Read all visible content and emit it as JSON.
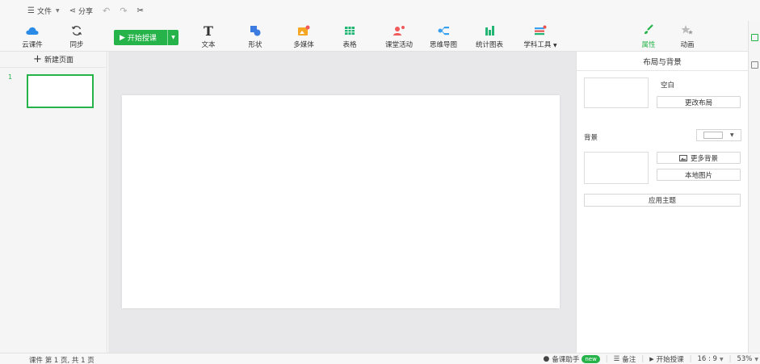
{
  "menubar": {
    "file_label": "文件",
    "share_label": "分享"
  },
  "ribbon": {
    "cloud_label": "云课件",
    "sync_label": "同步",
    "start_label": "开始授课",
    "text_label": "文本",
    "shape_label": "形状",
    "media_label": "多媒体",
    "table_label": "表格",
    "activity_label": "课堂活动",
    "mindmap_label": "思维导图",
    "chart_label": "统计图表",
    "subject_tools_label": "学科工具"
  },
  "right_tabs": {
    "attributes_label": "属性",
    "animation_label": "动画"
  },
  "left_panel": {
    "new_page_label": "新建页面",
    "thumb_number": "1"
  },
  "right_panel": {
    "title": "布局与背景",
    "layout_name": "空白",
    "change_layout_label": "更改布局",
    "background_label": "背景",
    "more_backgrounds_label": "更多背景",
    "local_image_label": "本地图片",
    "apply_theme_label": "应用主题"
  },
  "statusbar": {
    "page_info": "课件 第 1 页, 共 1 页",
    "assistant_label": "备课助手",
    "new_badge": "new",
    "notes_label": "备注",
    "start_label": "开始授课",
    "ratio_label": "16 : 9",
    "zoom_label": "53%"
  },
  "colors": {
    "accent_green": "#26b34a",
    "cloud_blue": "#2a8ae8",
    "shape_blue": "#3c7be0",
    "media_orange": "#f5a623",
    "activity_red": "#f05a5a",
    "mindmap_blue": "#3aa0f0",
    "chart_green": "#22b573",
    "subject_red": "#e8534f"
  }
}
